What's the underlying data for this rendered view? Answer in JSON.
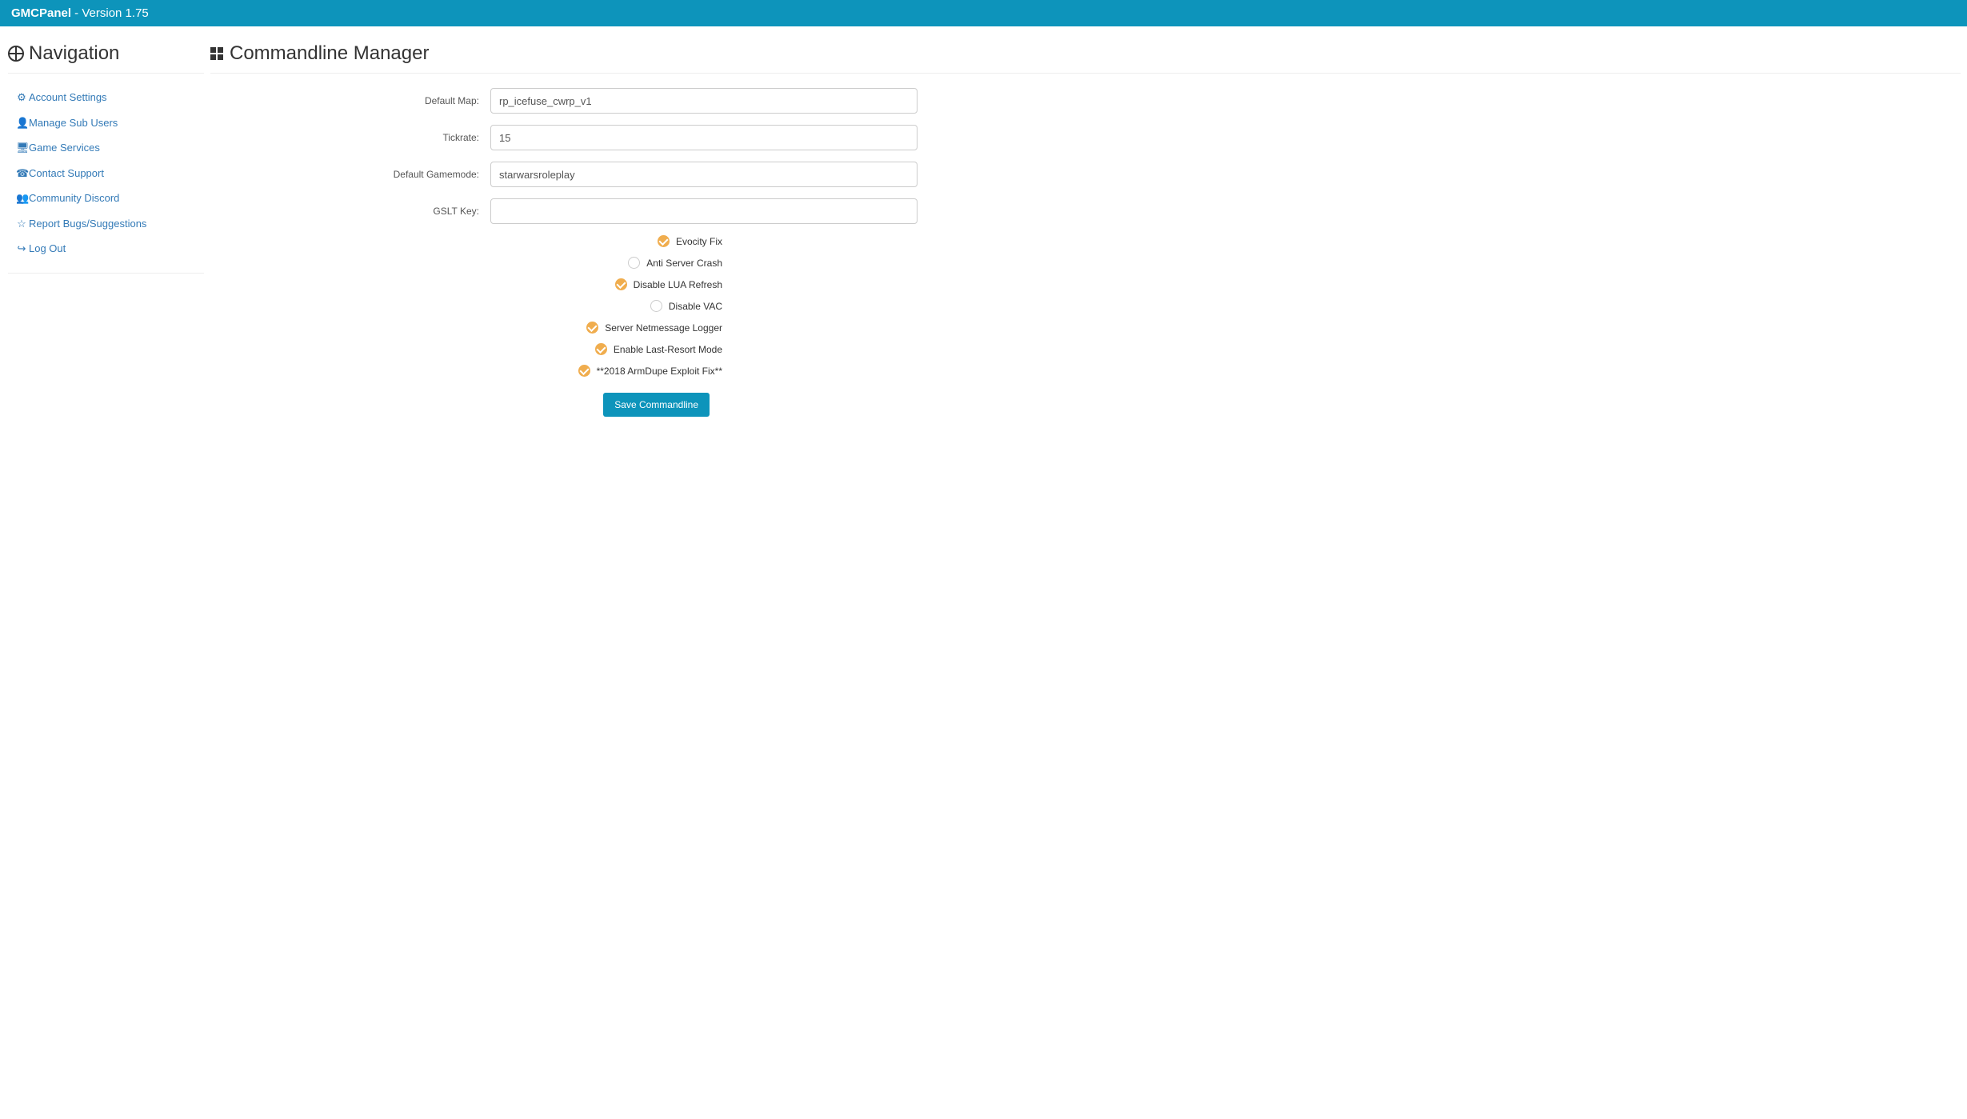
{
  "header": {
    "brand": "GMCPanel",
    "sep": " - ",
    "version": "Version 1.75"
  },
  "sidebar": {
    "title": "Navigation",
    "items": [
      {
        "icon": "⚙",
        "label": "Account Settings"
      },
      {
        "icon": "👤",
        "label": "Manage Sub Users"
      },
      {
        "icon": "🖥",
        "label": "Game Services"
      },
      {
        "icon": "☎",
        "label": "Contact Support"
      },
      {
        "icon": "👥",
        "label": "Community Discord"
      },
      {
        "icon": "☆",
        "label": "Report Bugs/Suggestions"
      },
      {
        "icon": "↪",
        "label": "Log Out"
      }
    ]
  },
  "page": {
    "title": "Commandline Manager"
  },
  "form": {
    "fields": {
      "default_map": {
        "label": "Default Map:",
        "value": "rp_icefuse_cwrp_v1"
      },
      "tickrate": {
        "label": "Tickrate:",
        "value": "15"
      },
      "gamemode": {
        "label": "Default Gamemode:",
        "value": "starwarsroleplay"
      },
      "gslt": {
        "label": "GSLT Key:",
        "value": ""
      }
    },
    "checks": [
      {
        "label": "Evocity Fix",
        "checked": true
      },
      {
        "label": "Anti Server Crash",
        "checked": false
      },
      {
        "label": "Disable LUA Refresh",
        "checked": true
      },
      {
        "label": "Disable VAC",
        "checked": false
      },
      {
        "label": "Server Netmessage Logger",
        "checked": true
      },
      {
        "label": "Enable Last-Resort Mode",
        "checked": true
      },
      {
        "label": "**2018 ArmDupe Exploit Fix**",
        "checked": true
      }
    ],
    "submit_label": "Save Commandline"
  }
}
